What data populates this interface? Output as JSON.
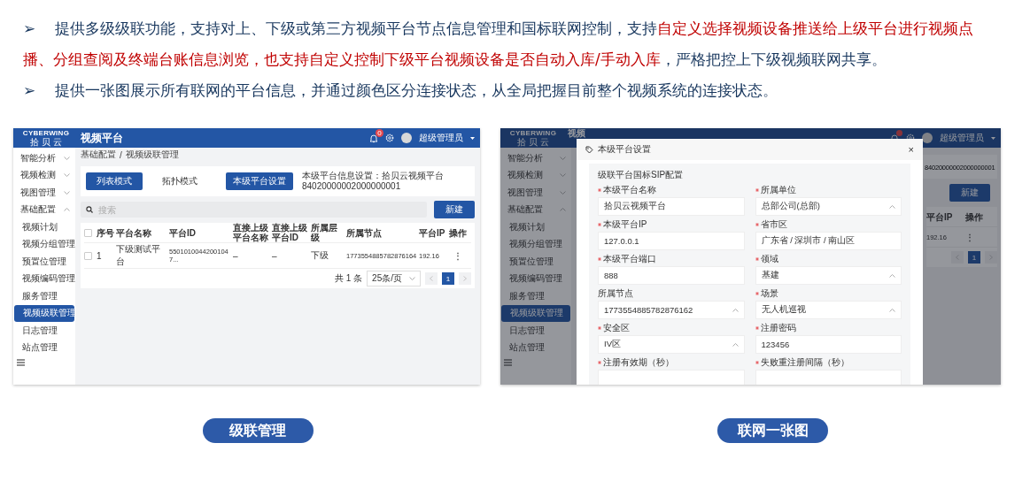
{
  "bullets": [
    {
      "marker": "➢",
      "segments": [
        {
          "text": "提供多级级联功能，支持对上、下级或第三方视频平台节点信息管理和国标联网控制，支持",
          "highlight": false
        },
        {
          "text": "自定义选择视频设备推送给上级平台进行视频点播、分组查阅及终端台账信息浏览，也支持自定义控制下级平台视频设备是否自动入库/手动入库",
          "highlight": true
        },
        {
          "text": "，严格把控上下级视频联网共享。",
          "highlight": false
        }
      ]
    },
    {
      "marker": "➢",
      "segments": [
        {
          "text": "提供一张图展示所有联网的平台信息，并通过颜色区分连接状态，从全局把握目前整个视频系统的连接状态。",
          "highlight": false
        }
      ]
    }
  ],
  "screenshots": [
    {
      "kind": "list",
      "logo": {
        "brand": "CYBERWING",
        "name": "拾 贝 云"
      },
      "title": "视频平台",
      "notification_count": "0",
      "user": "超级管理员",
      "sidebar": [
        {
          "label": "智能分析",
          "expanded": false,
          "selected": false
        },
        {
          "label": "视频检测",
          "expanded": false,
          "selected": false
        },
        {
          "label": "视图管理",
          "expanded": false,
          "selected": false
        },
        {
          "label": "基础配置",
          "expanded": true,
          "selected": false,
          "children": [
            {
              "label": "视频计划",
              "selected": false
            },
            {
              "label": "视频分组管理",
              "selected": false
            },
            {
              "label": "预置位管理",
              "selected": false
            },
            {
              "label": "视频编码管理",
              "selected": false
            },
            {
              "label": "服务管理",
              "selected": false
            },
            {
              "label": "视频级联管理",
              "selected": true
            },
            {
              "label": "日志管理",
              "selected": false
            },
            {
              "label": "站点管理",
              "selected": false
            }
          ]
        }
      ],
      "breadcrumb": {
        "items": [
          "基础配置",
          "视频级联管理"
        ],
        "separator": "/"
      },
      "tabs": [
        {
          "label": "列表模式",
          "selected": true
        },
        {
          "label": "拓扑模式",
          "selected": false
        }
      ],
      "settings_button": "本级平台设置",
      "platform_info": "本级平台信息设置：拾贝云视频平台 84020000002000000001",
      "search": {
        "placeholder": "搜索"
      },
      "new_button": "新建",
      "table": {
        "header_checked": false,
        "columns": [
          "序号",
          "平台名称",
          "平台ID",
          "直接上级平台名称",
          "直接上级平台ID",
          "所属层级",
          "所属节点",
          "平台IP",
          "操作"
        ],
        "rows": [
          {
            "checked": false,
            "cells": [
              "1",
              "下级测试平台",
              "55010100442001047...",
              "–",
              "–",
              "下级",
              "1773554885782876164",
              "192.16"
            ],
            "action": "⋮"
          }
        ]
      },
      "pagination": {
        "total": "共 1 条",
        "page_size": "25条/页",
        "pages": [
          {
            "label": "1",
            "selected": true
          }
        ]
      }
    },
    {
      "kind": "modal",
      "logo": {
        "brand": "CYBERWING",
        "name": "拾 贝 云"
      },
      "title": "视频",
      "user": "超级管理员",
      "sidebar": [
        {
          "label": "智能分析",
          "expanded": false,
          "selected": false
        },
        {
          "label": "视频检测",
          "expanded": false,
          "selected": false
        },
        {
          "label": "视图管理",
          "expanded": false,
          "selected": false
        },
        {
          "label": "基础配置",
          "expanded": true,
          "selected": false,
          "children": [
            {
              "label": "视频计划",
              "selected": false
            },
            {
              "label": "视频分组管理",
              "selected": false
            },
            {
              "label": "预置位管理",
              "selected": false
            },
            {
              "label": "视频编码管理",
              "selected": false
            },
            {
              "label": "服务管理",
              "selected": false
            },
            {
              "label": "视频级联管理",
              "selected": true
            },
            {
              "label": "日志管理",
              "selected": false
            },
            {
              "label": "站点管理",
              "selected": false
            }
          ]
        }
      ],
      "info_fragment": "84020000002000000001",
      "new_button": "新建",
      "table": {
        "columns": [
          "平台IP",
          "操作"
        ],
        "rows": [
          {
            "cells": [
              "192.16"
            ],
            "action": "⋮"
          }
        ]
      },
      "pagination": {
        "pages": [
          {
            "label": "1",
            "selected": true
          }
        ]
      },
      "dialog": {
        "title": "本级平台设置",
        "close": "×",
        "section": "级联平台国标SIP配置",
        "fields": [
          {
            "label": "本级平台名称",
            "required": true,
            "kind": "input",
            "value": "拾贝云视频平台"
          },
          {
            "label": "所属单位",
            "required": true,
            "kind": "select",
            "value": "总部公司(总部)"
          },
          {
            "label": "本级平台IP",
            "required": true,
            "kind": "input",
            "value": "127.0.0.1"
          },
          {
            "label": "省市区",
            "required": true,
            "kind": "input",
            "value": "广东省 / 深圳市 / 南山区"
          },
          {
            "label": "本级平台端口",
            "required": true,
            "kind": "input",
            "value": "888"
          },
          {
            "label": "领域",
            "required": true,
            "kind": "select",
            "value": "基建"
          },
          {
            "label": "所属节点",
            "required": false,
            "kind": "select",
            "value": "1773554885782876162"
          },
          {
            "label": "场景",
            "required": true,
            "kind": "select",
            "value": "无人机巡视"
          },
          {
            "label": "安全区",
            "required": true,
            "kind": "select",
            "value": "IV区"
          },
          {
            "label": "注册密码",
            "required": true,
            "kind": "input",
            "value": "123456"
          },
          {
            "label": "注册有效期（秒）",
            "required": true,
            "kind": "input"
          },
          {
            "label": "失败重注册间隔（秒）",
            "required": true,
            "kind": "input"
          }
        ]
      }
    }
  ],
  "captions": [
    "级联管理",
    "联网一张图"
  ]
}
